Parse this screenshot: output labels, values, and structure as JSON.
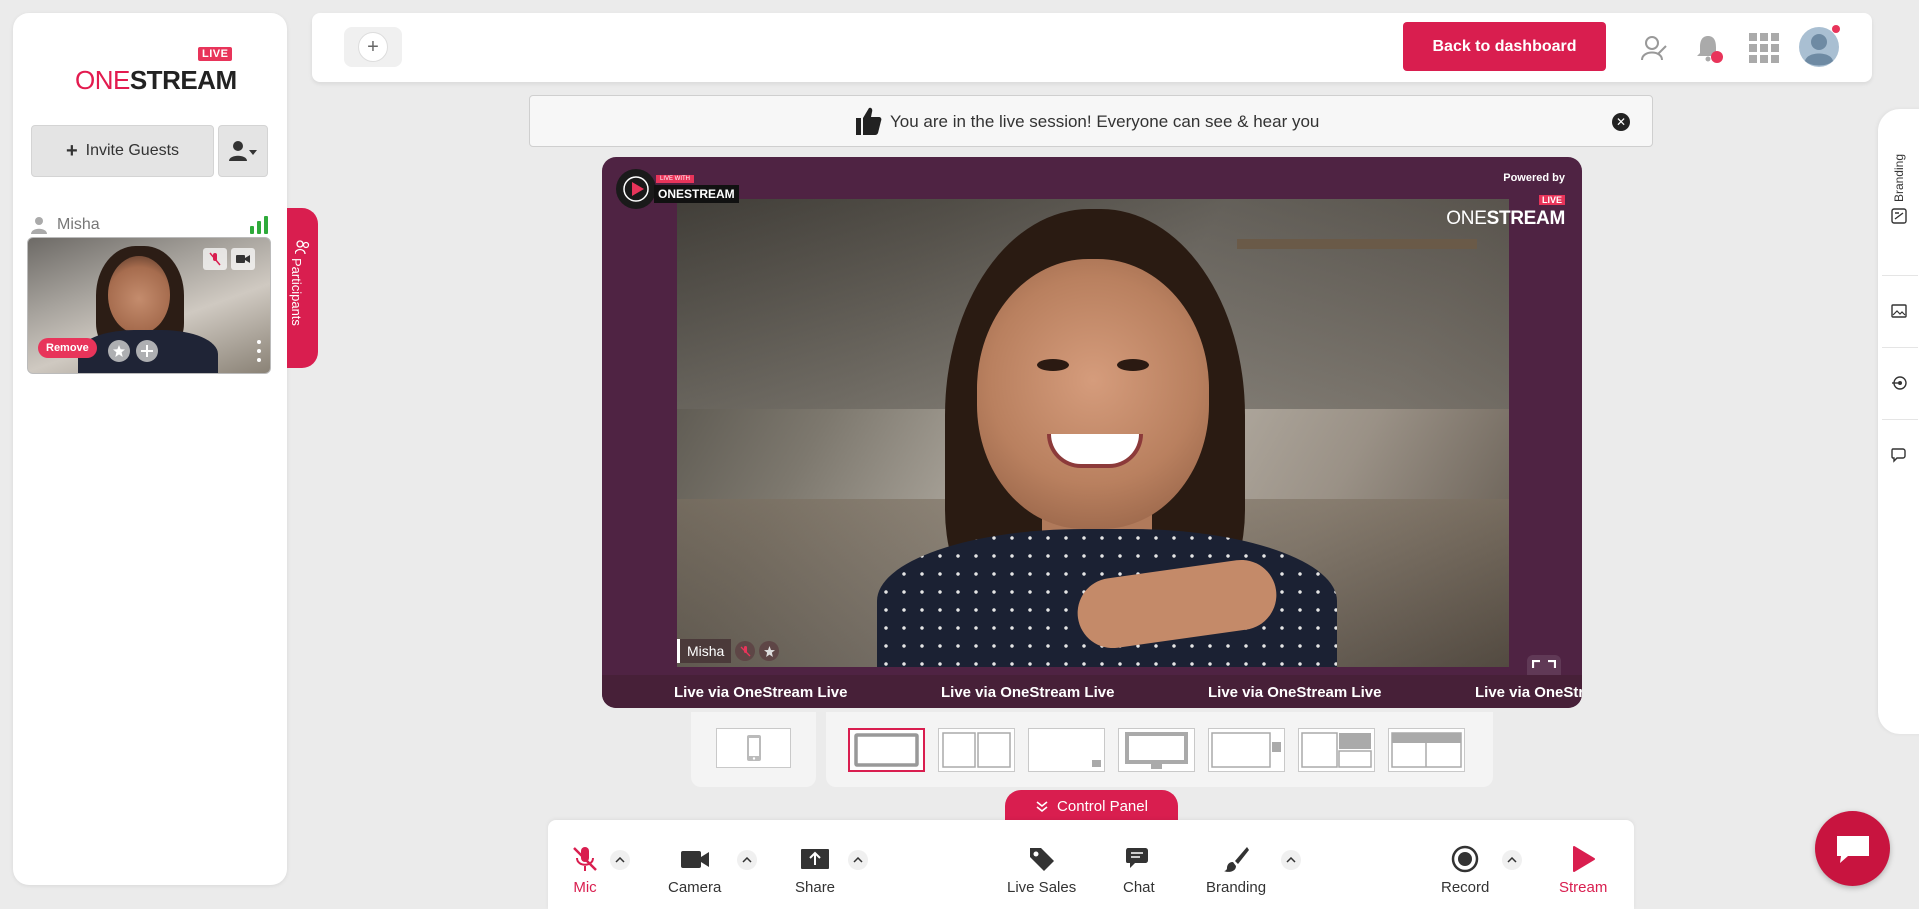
{
  "brand": {
    "live_badge": "LIVE",
    "one": "ONE",
    "stream": "STREAM"
  },
  "sidebar": {
    "invite_label": "Invite Guests",
    "participant": {
      "name": "Misha",
      "remove_label": "Remove"
    },
    "participants_tab": "Participants"
  },
  "topbar": {
    "back_label": "Back to dashboard"
  },
  "banner": {
    "text": "You are in the live session! Everyone can see & hear you"
  },
  "stage": {
    "logo_small": "LIVE WITH",
    "logo_name": "ONESTREAM",
    "powered_by": "Powered by",
    "brand_live": "LIVE",
    "brand_one": "ONE",
    "brand_stream": "STREAM",
    "name_tag": "Misha",
    "ticker": [
      "Live via OneStream Live",
      "Live via OneStream Live",
      "Live via OneStream Live",
      "Live via OneStream Live"
    ]
  },
  "control_panel": {
    "tab_label": "Control Panel"
  },
  "controls": {
    "mic": "Mic",
    "camera": "Camera",
    "share": "Share",
    "live_sales": "Live Sales",
    "chat": "Chat",
    "branding": "Branding",
    "record": "Record",
    "stream": "Stream"
  },
  "right_rail": {
    "branding_label": "Branding"
  },
  "colors": {
    "accent": "#d91e4f",
    "stage_bg": "#4f2343",
    "signal": "#2eaa3a"
  }
}
